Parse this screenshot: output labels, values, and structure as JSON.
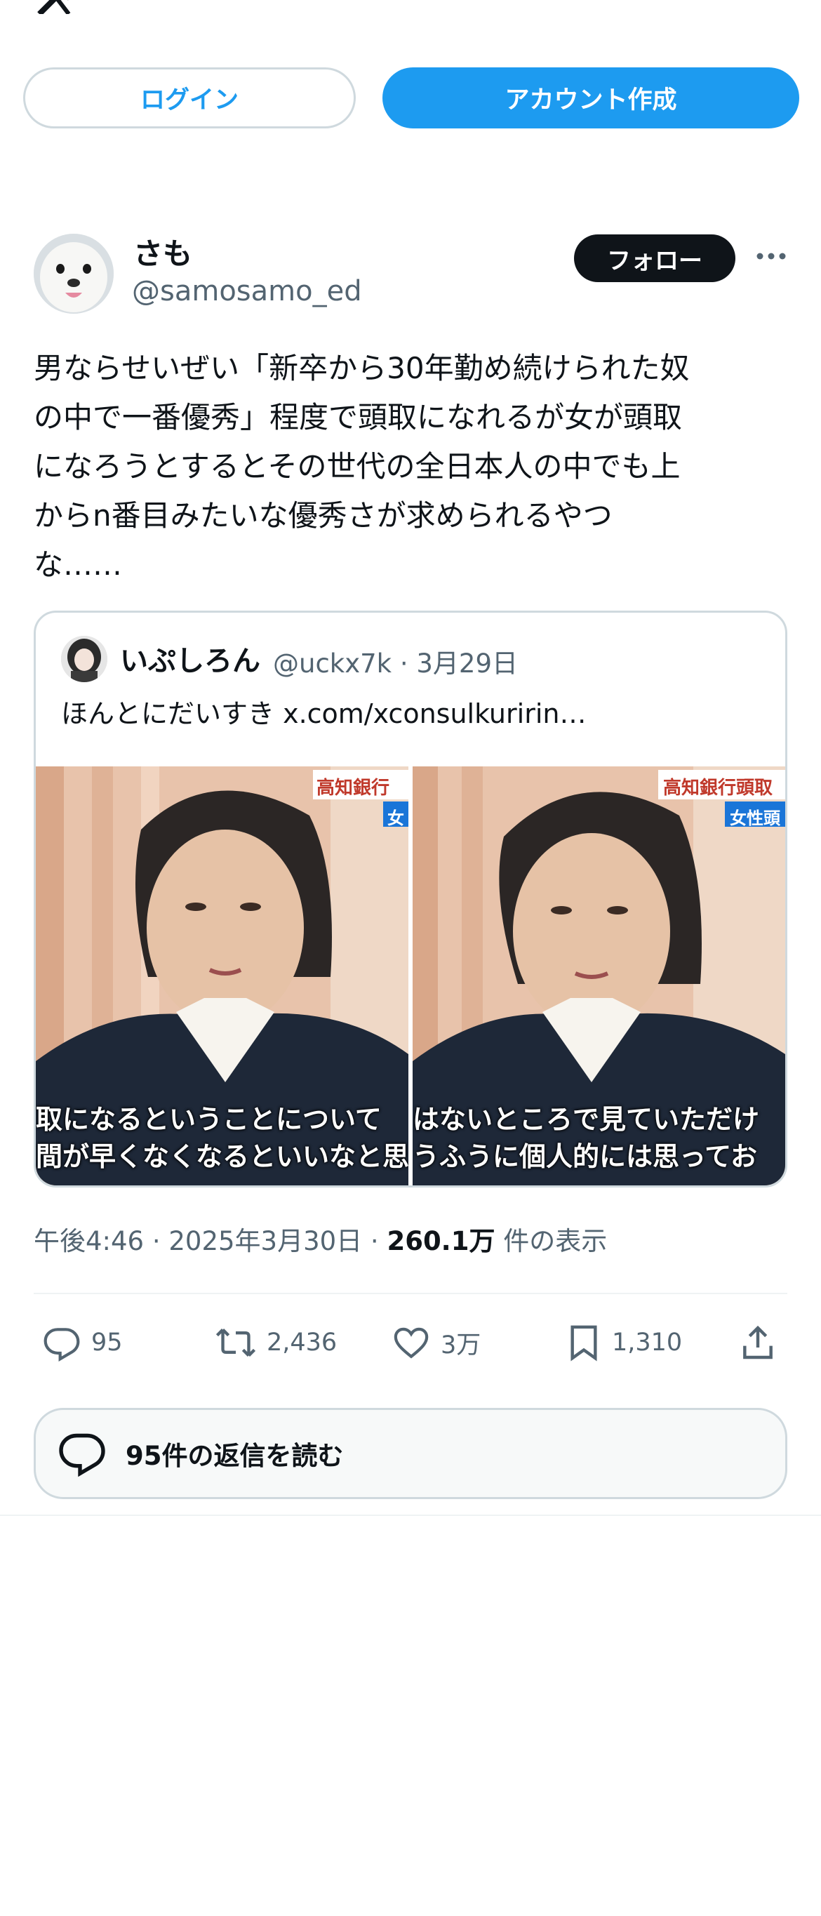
{
  "header": {
    "logo_icon": "x-logo-icon"
  },
  "auth": {
    "login_label": "ログイン",
    "signup_label": "アカウント作成"
  },
  "tweet": {
    "author_name": "さも",
    "author_handle": "@samosamo_ed",
    "follow_label": "フォロー",
    "text": "男ならせいぜい「新卒から30年勤め続けられた奴\nの中で一番優秀」程度で頭取になれるが女が頭取\nになろうとするとその世代の全日本人の中でも上\nからn番目みたいな優秀さが求められるやつ\nな……",
    "quote": {
      "author_name": "いぷしろん",
      "meta": "@uckx7k · 3月29日",
      "text": "ほんとにだいすき  x.com/xconsulkuririn…",
      "images": [
        {
          "banner": "高知銀行",
          "sub": "女",
          "caption_line1": "取になるということについて",
          "caption_line2": "間が早くなくなるといいなと思"
        },
        {
          "banner": "高知銀行頭取",
          "sub": "女性頭",
          "caption_line1": "はないところで見ていただけ",
          "caption_line2": "うふうに個人的には思ってお"
        }
      ]
    },
    "time": "午後4:46 · 2025年3月30日 · ",
    "views_count": "260.1万",
    "views_label": " 件の表示",
    "actions": {
      "replies": "95",
      "retweets": "2,436",
      "likes": "3万",
      "bookmarks": "1,310"
    },
    "read_replies_label": "95件の返信を読む"
  },
  "colors": {
    "accent": "#1d9bf0",
    "text": "#0f1419",
    "muted": "#536471",
    "border": "#cfd9de"
  }
}
